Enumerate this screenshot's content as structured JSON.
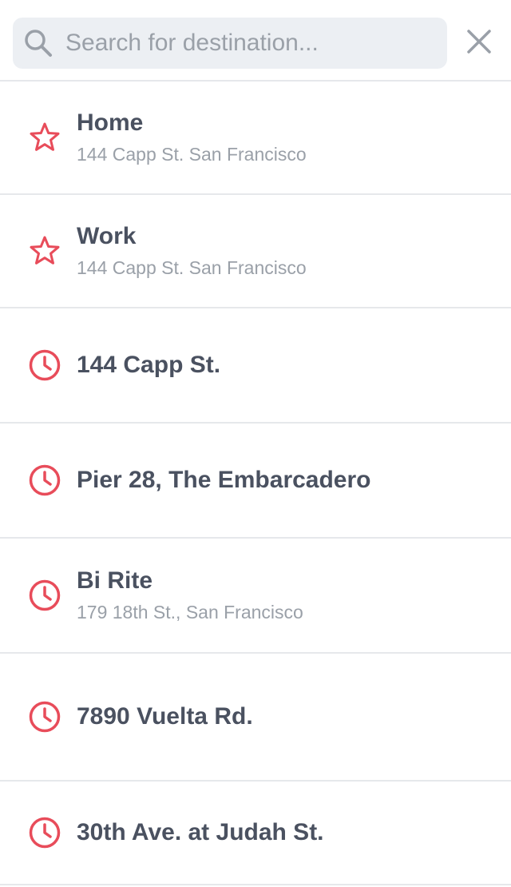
{
  "search": {
    "placeholder": "Search for destination...",
    "value": ""
  },
  "colors": {
    "accent": "#e84c5a",
    "text": "#4a5160",
    "muted": "#9aa0a8",
    "search_bg": "#eceff3",
    "divider": "#e6e8eb"
  },
  "items": [
    {
      "icon": "star-icon",
      "title": "Home",
      "subtitle": "144 Capp St. San Francisco"
    },
    {
      "icon": "star-icon",
      "title": "Work",
      "subtitle": "144 Capp St. San Francisco"
    },
    {
      "icon": "clock-icon",
      "title": "144 Capp St.",
      "subtitle": ""
    },
    {
      "icon": "clock-icon",
      "title": "Pier 28, The Embarcadero",
      "subtitle": ""
    },
    {
      "icon": "clock-icon",
      "title": "Bi Rite",
      "subtitle": "179 18th St., San Francisco"
    },
    {
      "icon": "clock-icon",
      "title": "7890 Vuelta Rd.",
      "subtitle": ""
    },
    {
      "icon": "clock-icon",
      "title": "30th Ave. at Judah St.",
      "subtitle": ""
    }
  ]
}
